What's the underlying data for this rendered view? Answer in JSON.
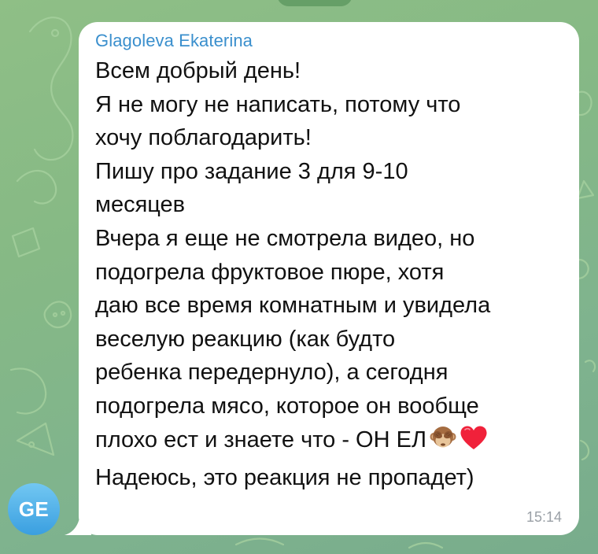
{
  "chat": {
    "message": {
      "sender_name": "Glagoleva Ekaterina",
      "lines": [
        "Всем добрый день!",
        "Я не могу не написать, потому что",
        "хочу поблагодарить!",
        "Пишу про задание 3 для 9-10",
        "месяцев",
        "Вчера я еще не смотрела видео, но",
        "подогрела фруктовое пюре, хотя",
        "даю все время комнатным и увидела",
        "веселую реакцию (как будто",
        "ребенка передернуло), а сегодня",
        "подогрела мясо, которое он вообще",
        "плохо ест и знаете что - ОН ЕЛ",
        "Надеюсь, это реакция не пропадет)"
      ],
      "emojis": [
        "see-no-evil-monkey-icon",
        "red-heart-icon"
      ],
      "time": "15:14"
    },
    "avatar": {
      "initials": "GE"
    },
    "colors": {
      "sender_name": "#3a8fcd",
      "avatar_top": "#72c7f2",
      "avatar_bottom": "#3a9fe0",
      "background": "#86b985",
      "bubble": "#ffffff"
    }
  }
}
